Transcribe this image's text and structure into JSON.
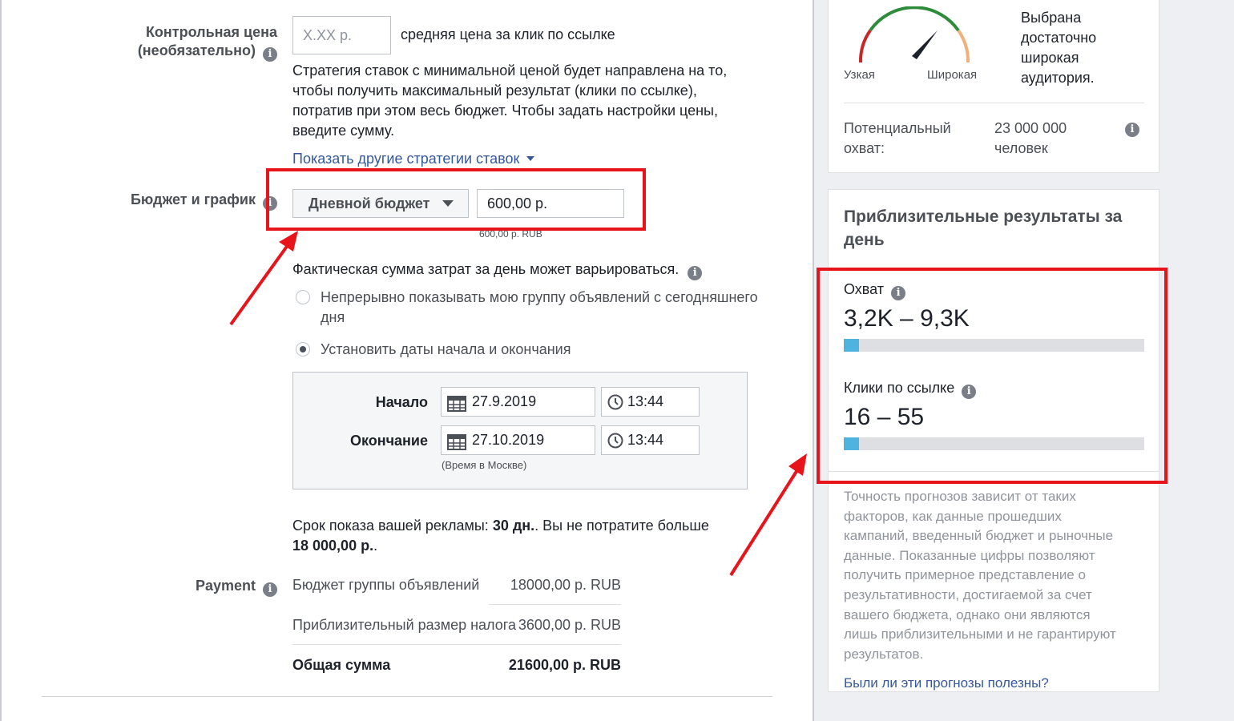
{
  "bid": {
    "label_line1": "Контрольная цена",
    "label_line2": "(необязательно)",
    "placeholder": "X.XX р.",
    "suffix": "средняя цена за клик по ссылке",
    "desc_lines": [
      "Стратегия ставок с минимальной ценой будет направлена на то,",
      "чтобы получить максимальный результат (клики по ссылке),",
      "потратив при этом весь бюджет. Чтобы задать настройки цены,",
      "введите сумму."
    ],
    "show_strategies": "Показать другие стратегии ставок"
  },
  "budget": {
    "label": "Бюджет и график",
    "type_button": "Дневной бюджет",
    "amount": "600,00 р.",
    "amount_hint": "600,00 р. RUB",
    "variation_note": "Фактическая сумма затрат за день может варьироваться.",
    "radio_continuous_line1": "Непрерывно показывать мою группу объявлений с сегодняшнего",
    "radio_continuous_line2": "дня",
    "radio_dates": "Установить даты начала и окончания",
    "start_label": "Начало",
    "start_date": "27.9.2019",
    "start_time": "13:44",
    "end_label": "Окончание",
    "end_date": "27.10.2019",
    "end_time": "13:44",
    "timezone": "(Время в Москве)",
    "duration_pre": "Срок показа вашей рекламы: ",
    "duration_bold": "30 дн.",
    "duration_mid": ". Вы не потратите больше",
    "duration_total": "18 000,00 р.",
    "duration_end": "."
  },
  "payment": {
    "label": "Payment",
    "rows": [
      {
        "label": "Бюджет группы объявлений",
        "value": "18000,00 р. RUB"
      },
      {
        "label": "Приблизительный размер налога",
        "value": "3600,00 р. RUB"
      },
      {
        "label": "Общая сумма",
        "value": "21600,00 р. RUB"
      }
    ]
  },
  "audience": {
    "gauge_left": "Узкая",
    "gauge_right": "Широкая",
    "status_lines": [
      "Выбрана",
      "достаточно",
      "широкая",
      "аудитория."
    ],
    "reach_label_line1": "Потенциальный",
    "reach_label_line2": "охват:",
    "reach_value_line1": "23 000 000",
    "reach_value_line2": "человек"
  },
  "estimates": {
    "title_line1": "Приблизительные результаты за",
    "title_line2": "день",
    "reach_label": "Охват",
    "reach_value": "3,2K – 9,3K",
    "reach_fill": 0.05,
    "clicks_label": "Клики по ссылке",
    "clicks_value": "16 – 55",
    "clicks_fill": 0.05,
    "disclaimer_lines": [
      "Точность прогнозов зависит от таких",
      "факторов, как данные прошедших",
      "кампаний, введенный бюджет и рыночные",
      "данные. Показанные цифры позволяют",
      "получить примерное представление о",
      "результативности, достигаемой за счет",
      "вашего бюджета, однако они являются",
      "лишь приблизительными и не гарантируют",
      "результатов."
    ],
    "feedback_link": "Были ли эти прогнозы полезны?"
  },
  "colors": {
    "highlight": "#e8141c",
    "accent": "#365899",
    "bar_fill": "#4fb3e0"
  }
}
